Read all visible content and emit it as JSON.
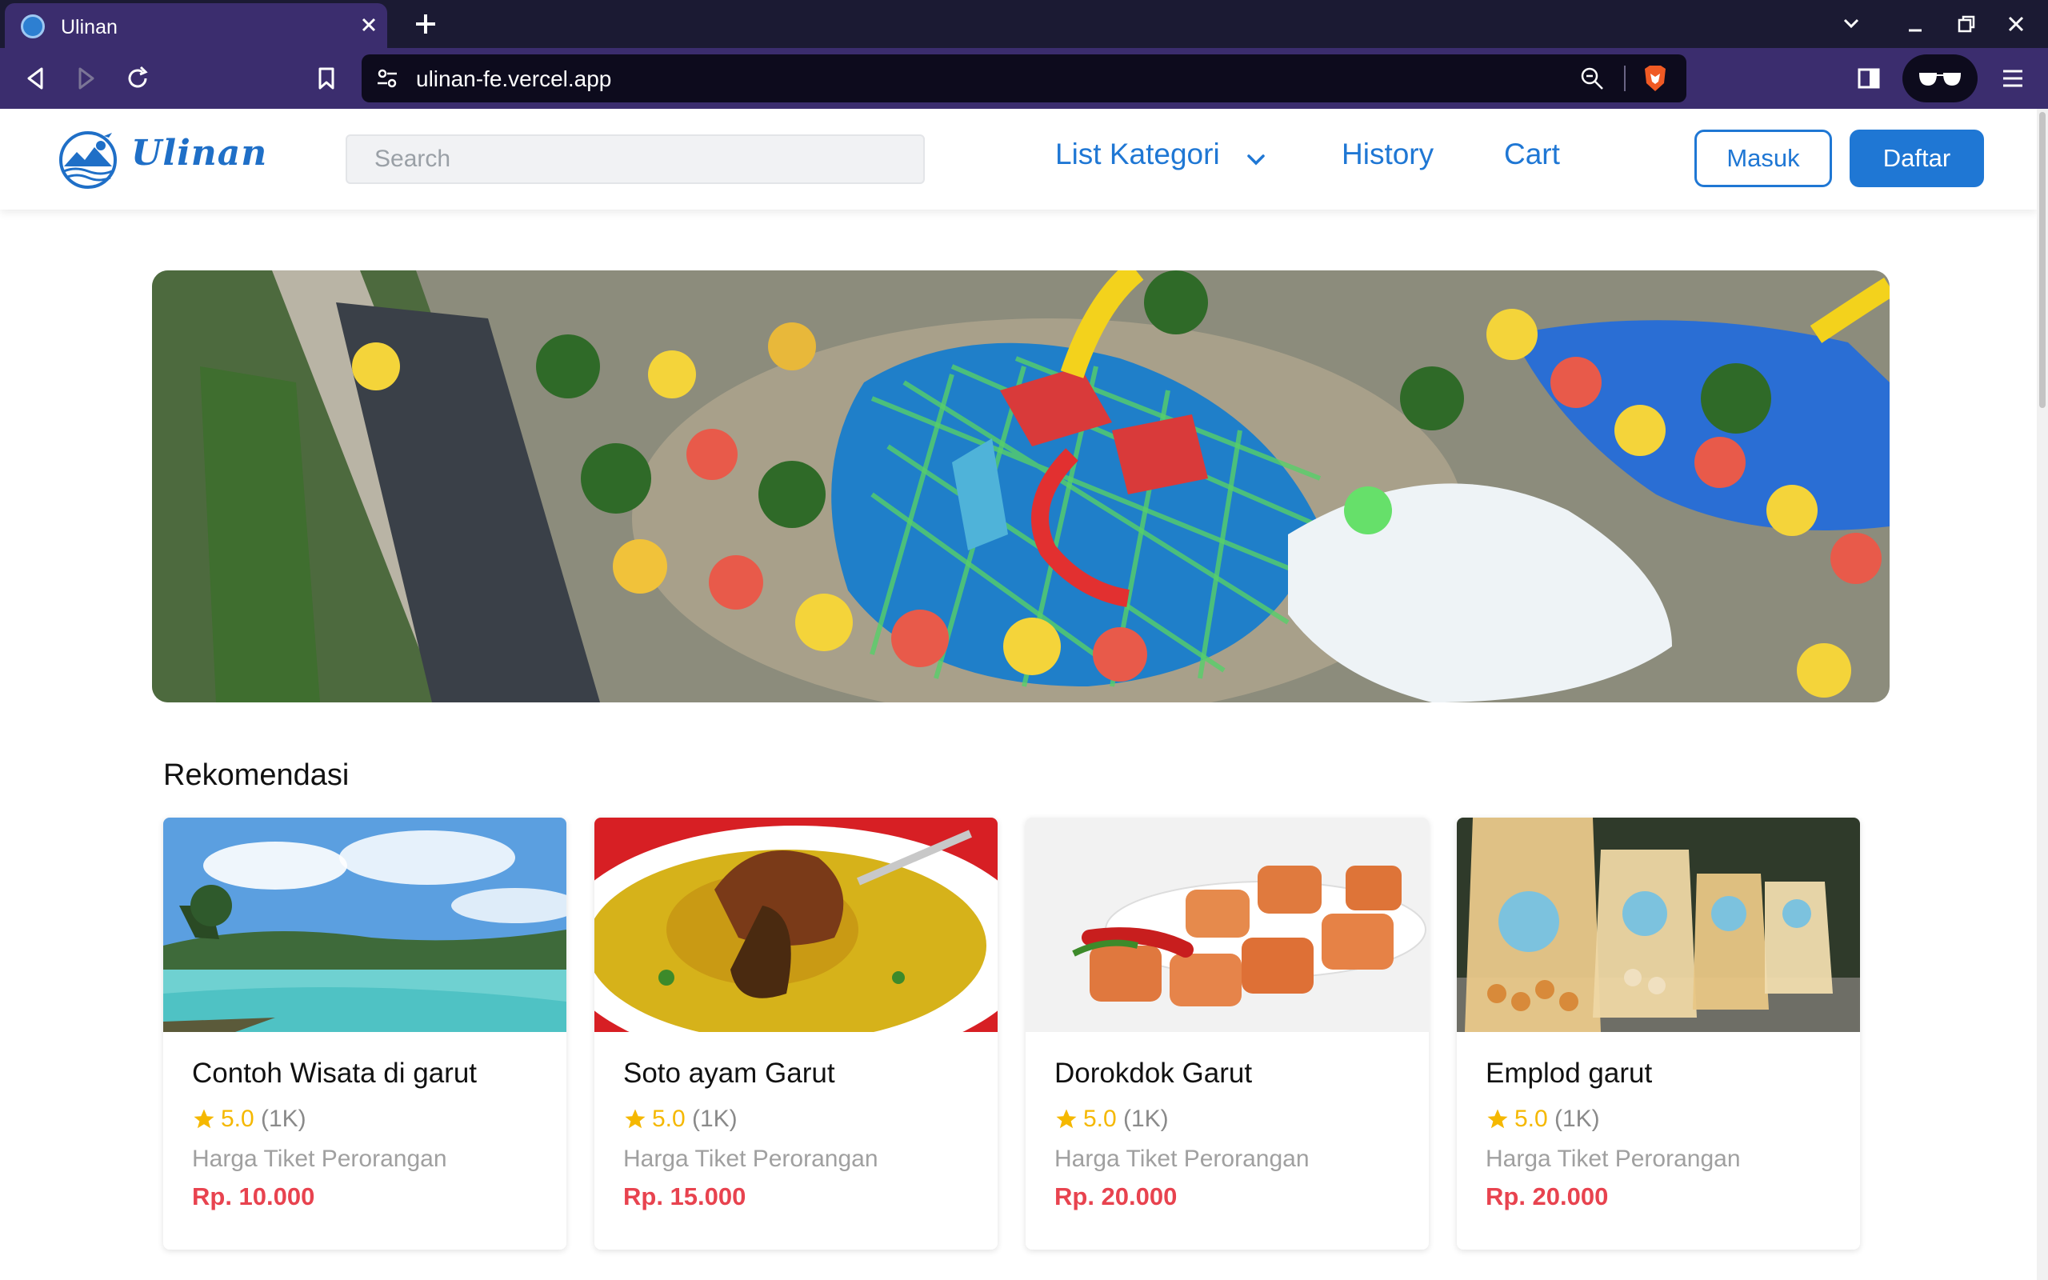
{
  "browser": {
    "tab_title": "Ulinan",
    "url": "ulinan-fe.vercel.app"
  },
  "navbar": {
    "brand": "Ulinan",
    "search_placeholder": "Search",
    "links": {
      "categories": "List Kategori",
      "history": "History",
      "cart": "Cart"
    },
    "login_label": "Masuk",
    "register_label": "Daftar"
  },
  "colors": {
    "brand_blue": "#1f77d4",
    "price_red": "#e8434f",
    "star_yellow": "#f5b800",
    "browser_purple": "#3b2d6e"
  },
  "recommendations": {
    "title": "Rekomendasi",
    "items": [
      {
        "name": "Contoh Wisata di garut",
        "rating": "5.0",
        "reviews": "(1K)",
        "label": "Harga Tiket Perorangan",
        "price": "Rp. 10.000",
        "image": "lake-landscape"
      },
      {
        "name": "Soto ayam Garut",
        "rating": "5.0",
        "reviews": "(1K)",
        "label": "Harga Tiket Perorangan",
        "price": "Rp. 15.000",
        "image": "soup-dish"
      },
      {
        "name": "Dorokdok Garut",
        "rating": "5.0",
        "reviews": "(1K)",
        "label": "Harga Tiket Perorangan",
        "price": "Rp. 20.000",
        "image": "crackers-plate"
      },
      {
        "name": "Emplod garut",
        "rating": "5.0",
        "reviews": "(1K)",
        "label": "Harga Tiket Perorangan",
        "price": "Rp. 20.000",
        "image": "snack-bags"
      }
    ]
  }
}
